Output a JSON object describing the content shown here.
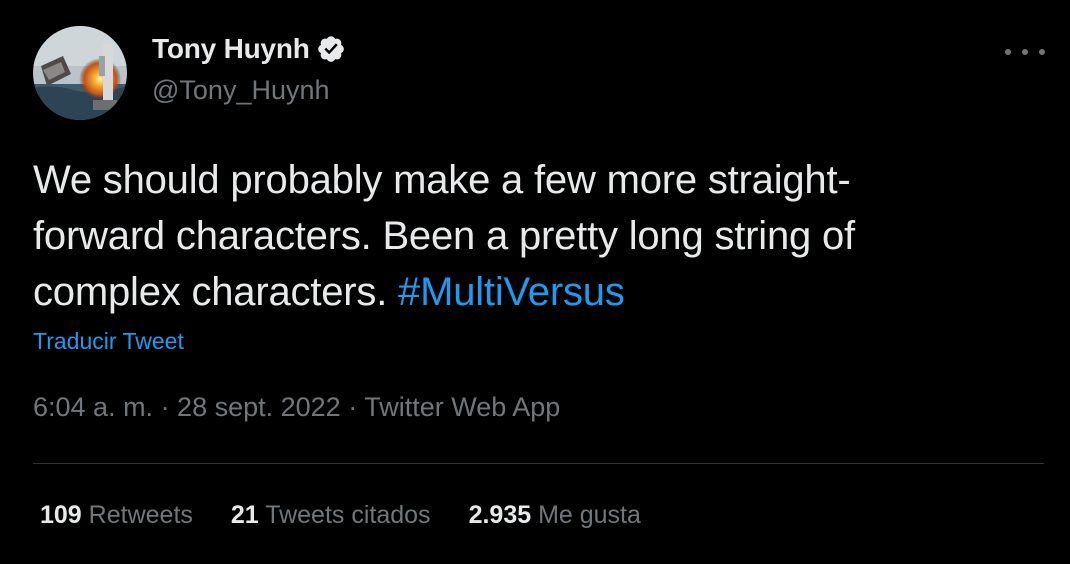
{
  "author": {
    "display_name": "Tony Huynh",
    "handle": "@Tony_Huynh",
    "verified": true,
    "avatar_icon": "avatar-explosion-photo"
  },
  "tweet": {
    "lines": [
      "We should probably make a few more straight-",
      "forward characters. Been a pretty long string of",
      "complex characters. "
    ],
    "hashtag": "#MultiVersus",
    "translate_label": "Traducir Tweet",
    "meta": "6:04 a. m. · 28 sept. 2022 · Twitter Web App"
  },
  "stats": [
    {
      "count": "109",
      "label": "Retweets"
    },
    {
      "count": "21",
      "label": "Tweets citados"
    },
    {
      "count": "2.935",
      "label": "Me gusta"
    }
  ],
  "colors": {
    "background": "#000000",
    "text": "#e7e9ea",
    "secondary": "#71767b",
    "link": "#1d9bf0",
    "divider": "#2f3336"
  },
  "icons": {
    "more": "more-horizontal-icon",
    "verified": "verified-badge-icon"
  }
}
